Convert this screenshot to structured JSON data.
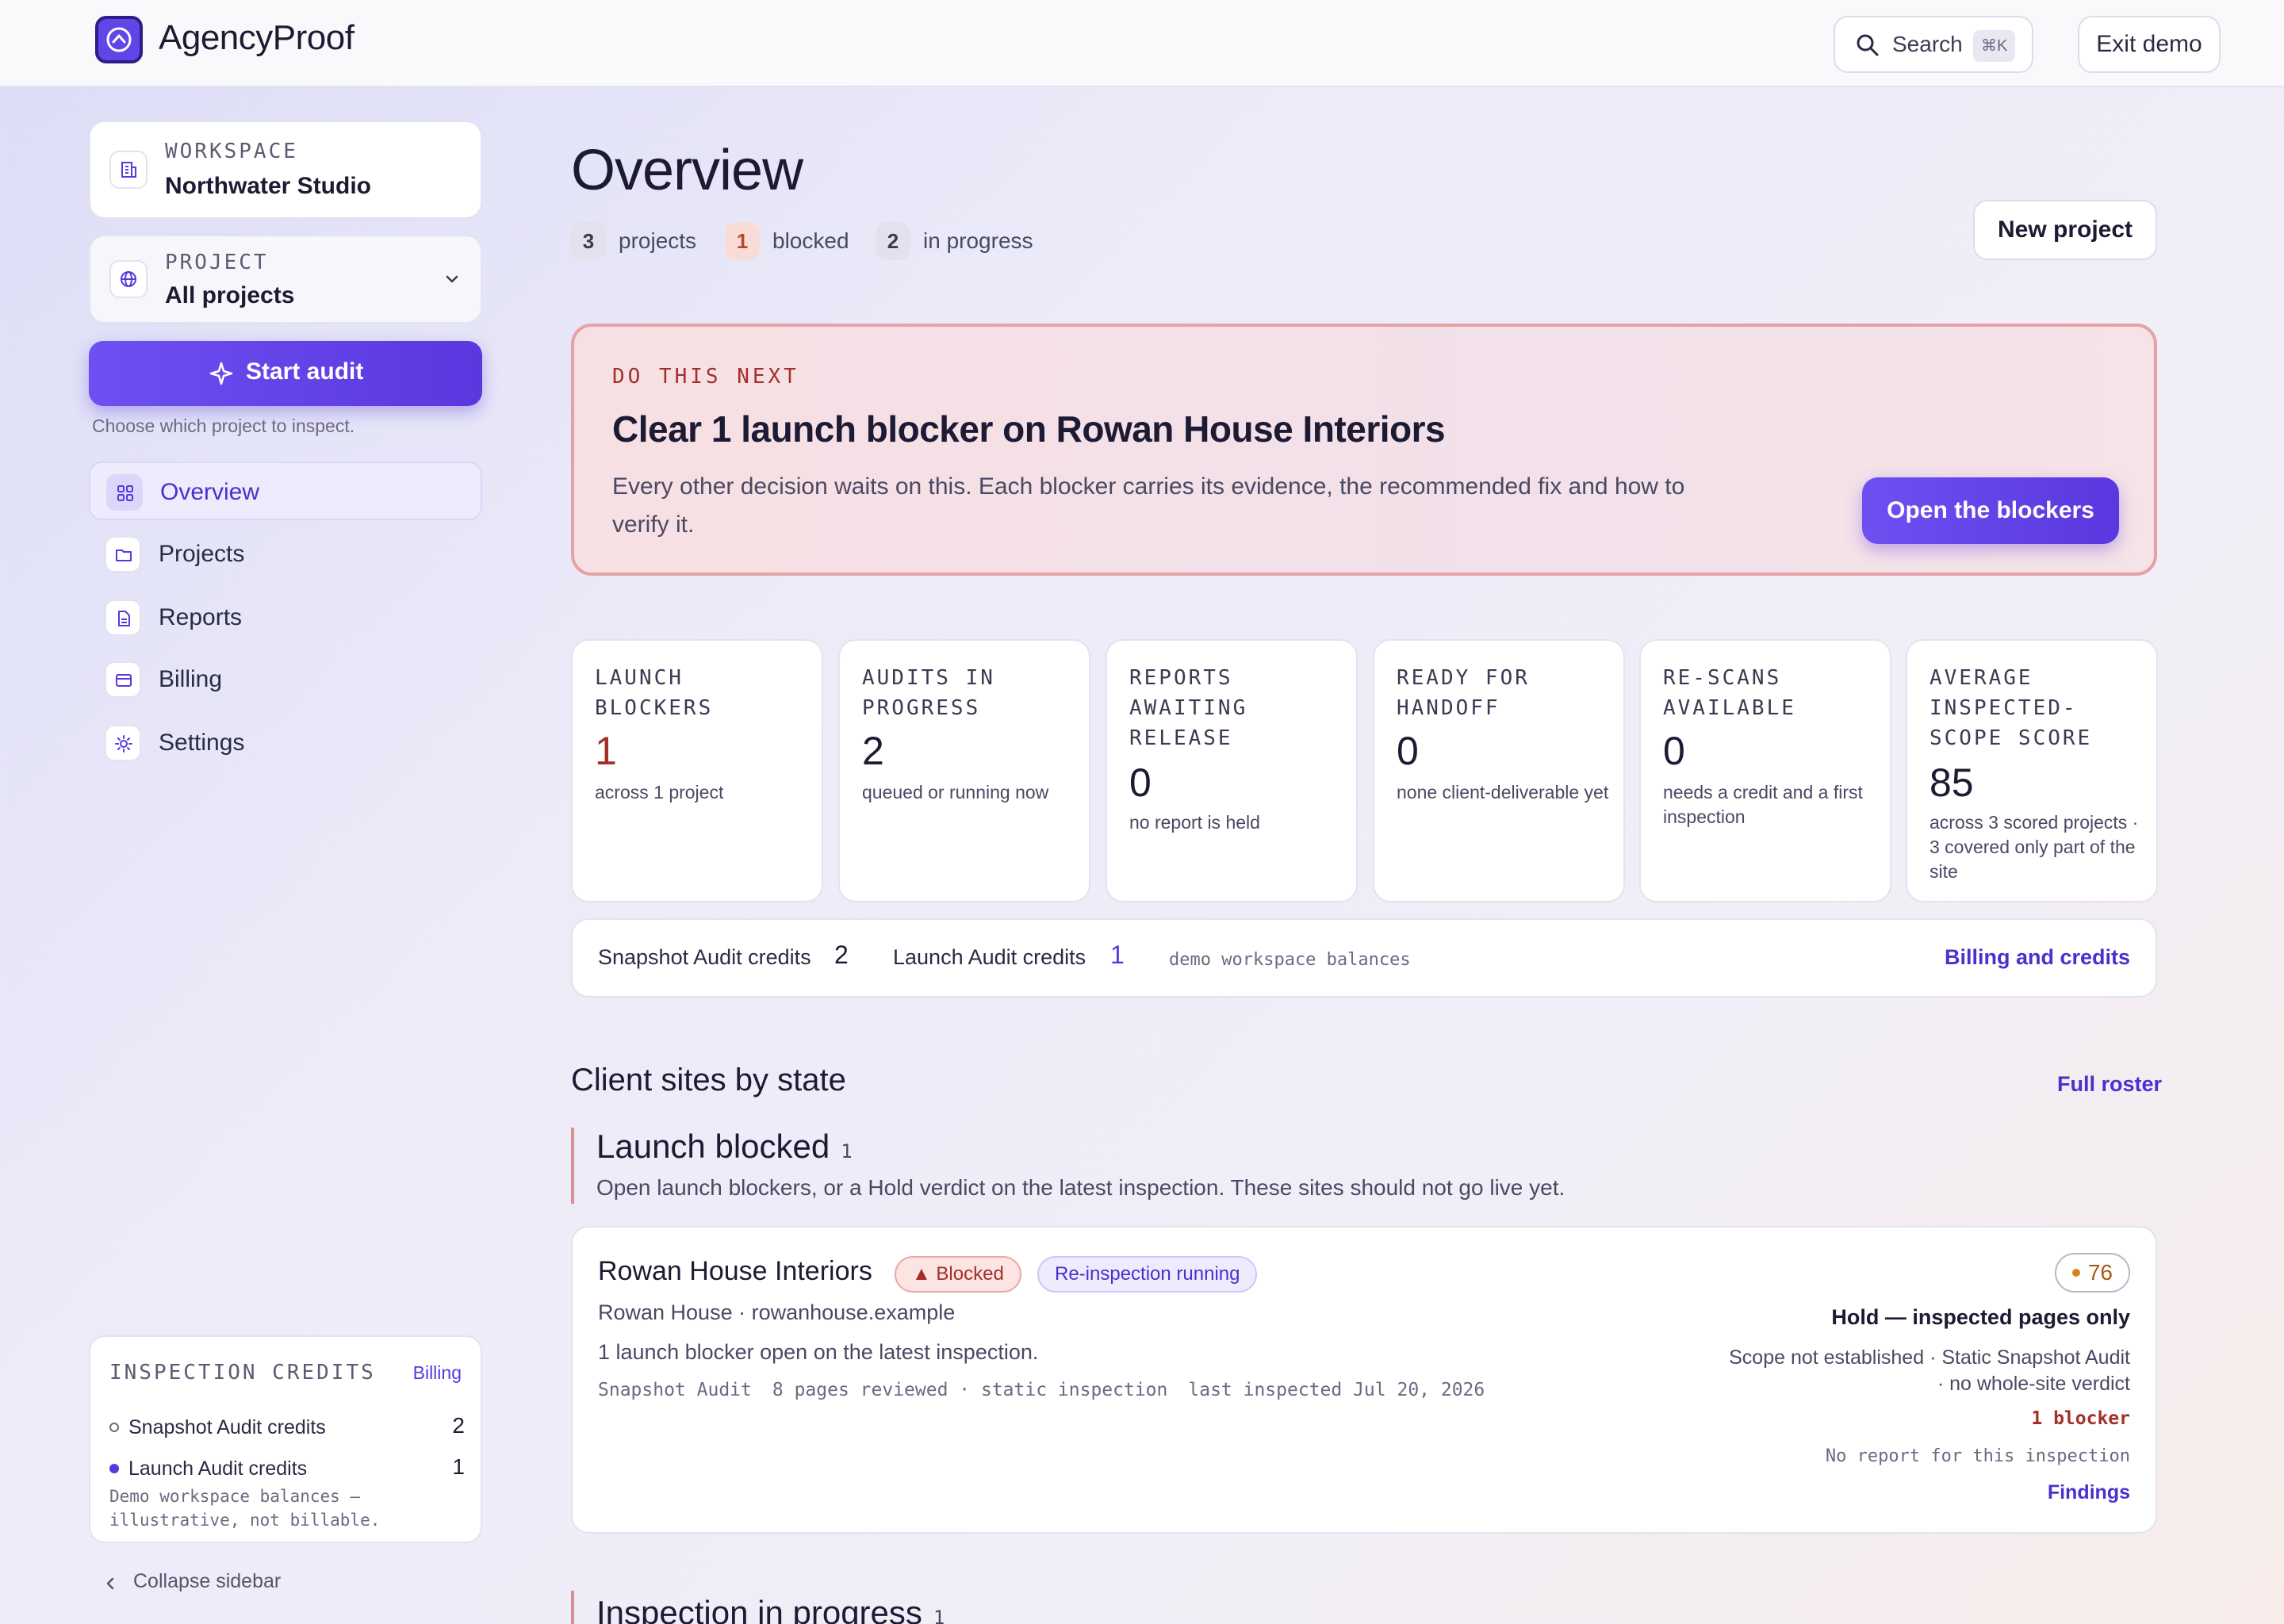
{
  "topbar": {
    "brand": "AgencyProof",
    "search_label": "Search",
    "search_shortcut": "⌘K",
    "exit_label": "Exit demo"
  },
  "sidebar": {
    "workspace": {
      "caption": "WORKSPACE",
      "value": "Northwater Studio"
    },
    "project": {
      "caption": "PROJECT",
      "value": "All projects"
    },
    "start_audit": "Start audit",
    "hint": "Choose which project to inspect.",
    "nav": [
      {
        "label": "Overview",
        "icon": "grid-icon",
        "active": true
      },
      {
        "label": "Projects",
        "icon": "folder-icon"
      },
      {
        "label": "Reports",
        "icon": "document-icon"
      },
      {
        "label": "Billing",
        "icon": "card-icon"
      },
      {
        "label": "Settings",
        "icon": "gear-icon"
      }
    ],
    "credits": {
      "caption": "INSPECTION CREDITS",
      "link": "Billing",
      "snapshot_label": "Snapshot Audit credits",
      "snapshot_value": "2",
      "launch_label": "Launch Audit credits",
      "launch_value": "1",
      "note": "Demo workspace balances — illustrative, not billable."
    },
    "collapse": "Collapse sidebar"
  },
  "main": {
    "title": "Overview",
    "stats": [
      {
        "count": "3",
        "label": "projects"
      },
      {
        "count": "1",
        "label": "blocked"
      },
      {
        "count": "2",
        "label": "in progress"
      }
    ],
    "new_project": "New project",
    "next": {
      "caption": "DO THIS NEXT",
      "title": "Clear 1 launch blocker on Rowan House Interiors",
      "body": "Every other decision waits on this. Each blocker carries its evidence, the recommended fix and how to verify it.",
      "button": "Open the blockers"
    },
    "metrics": [
      {
        "caption": "LAUNCH BLOCKERS",
        "value": "1",
        "desc": "across 1 project"
      },
      {
        "caption": "AUDITS IN PROGRESS",
        "value": "2",
        "desc": "queued or running now"
      },
      {
        "caption": "REPORTS AWAITING RELEASE",
        "value": "0",
        "desc": "no report is held"
      },
      {
        "caption": "READY FOR HANDOFF",
        "value": "0",
        "desc": "none client-deliverable yet"
      },
      {
        "caption": "RE-SCANS AVAILABLE",
        "value": "0",
        "desc": "needs a credit and a first inspection"
      },
      {
        "caption": "AVERAGE INSPECTED-SCOPE SCORE",
        "value": "85",
        "desc": "across 3 scored projects · 3 covered only part of the site"
      }
    ],
    "balances": {
      "snapshot_label": "Snapshot Audit credits",
      "snapshot_value": "2",
      "launch_label": "Launch Audit credits",
      "launch_value": "1",
      "note": "demo workspace balances",
      "link": "Billing and credits"
    },
    "section_title": "Client sites by state",
    "roster_link": "Full roster",
    "group_blocked": {
      "title": "Launch blocked",
      "count": "1",
      "desc": "Open launch blockers, or a Hold verdict on the latest inspection. These sites should not go live yet."
    },
    "site": {
      "name": "Rowan House Interiors",
      "badge_blocked": "▲ Blocked",
      "badge_running": "Re-inspection running",
      "domain": "Rowan House · rowanhouse.example",
      "summary": "1 launch blocker open on the latest inspection.",
      "meta_type": "Snapshot Audit",
      "meta_pages": "8 pages reviewed · static inspection",
      "meta_last": "last inspected Jul 20, 2026",
      "score": "76",
      "verdict": "Hold — inspected pages only",
      "scope": "Scope not established · Static Snapshot Audit · no whole-site verdict",
      "blockers": "1 blocker",
      "no_report": "No report for this inspection",
      "findings": "Findings"
    },
    "group_progress": {
      "title": "Inspection in progress",
      "count": "1"
    }
  },
  "colors": {
    "accent": "#5a37de",
    "danger": "#a32f2a",
    "warning": "#d7831e"
  }
}
